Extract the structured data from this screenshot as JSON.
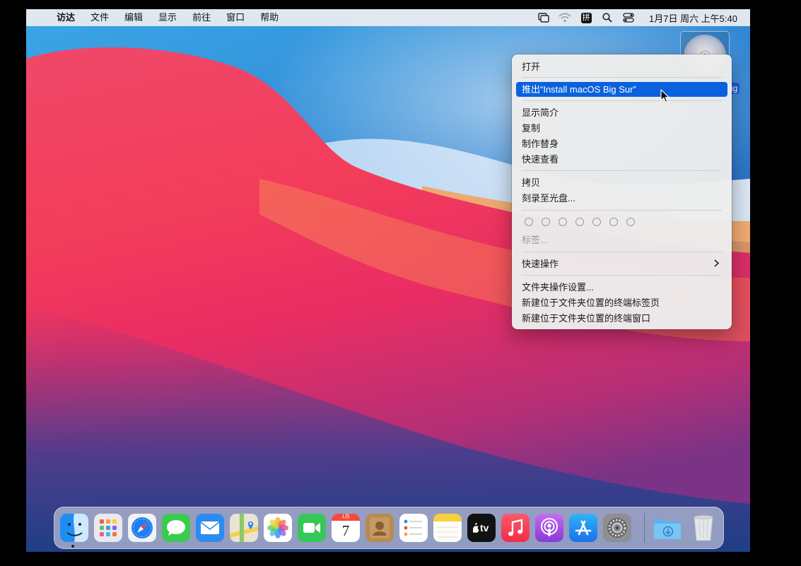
{
  "menubar": {
    "apple_glyph": "",
    "app_name": "访达",
    "items": [
      "文件",
      "编辑",
      "显示",
      "前往",
      "窗口",
      "帮助"
    ],
    "ime_label": "拼",
    "clock": "1月7日 周六 上午5:40"
  },
  "desktop": {
    "disk_label_fragment": "ig"
  },
  "context_menu": {
    "open": "打开",
    "eject": "推出“Install macOS Big Sur”",
    "get_info": "显示简介",
    "duplicate": "复制",
    "make_alias": "制作替身",
    "quick_look": "快速查看",
    "copy": "拷贝",
    "burn": "刻录至光盘...",
    "tags": "标签...",
    "quick_actions": "快速操作",
    "folder_actions": "文件夹操作设置...",
    "new_terminal_tab": "新建位于文件夹位置的终端标签页",
    "new_terminal_window": "新建位于文件夹位置的终端窗口",
    "tag_colors_count": 7
  },
  "dock": {
    "apps": [
      "finder-icon",
      "launchpad-icon",
      "safari-icon",
      "messages-icon",
      "mail-icon",
      "maps-icon",
      "photos-icon",
      "facetime-icon",
      "calendar-icon",
      "contacts-icon",
      "reminders-icon",
      "notes-icon",
      "apple-tv-icon",
      "music-icon",
      "podcasts-icon",
      "app-store-icon",
      "system-preferences-icon",
      "downloads-folder-icon",
      "trash-icon"
    ],
    "calendar_month": "1月",
    "calendar_day": "7",
    "tv_label": "tv",
    "running": [
      "finder-icon"
    ]
  },
  "colors": {
    "selection": "#0a61dd",
    "menubar_bg": "#eeeef2"
  }
}
